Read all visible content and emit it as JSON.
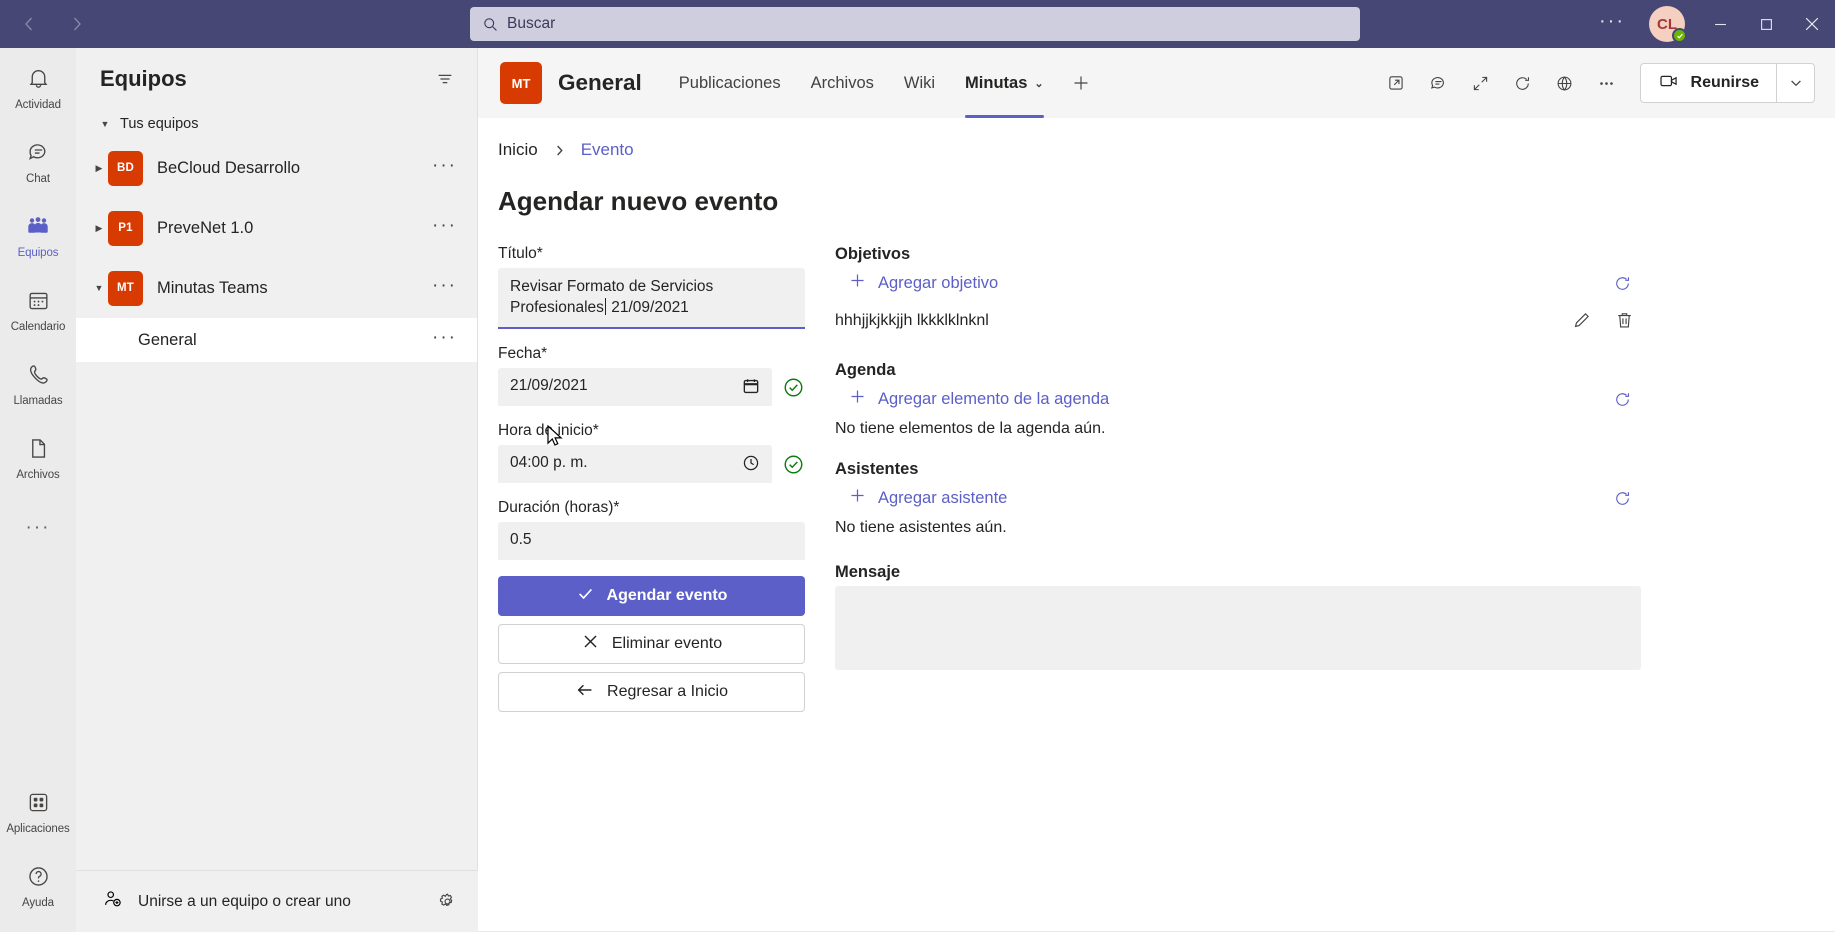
{
  "titlebar": {
    "back_tooltip": "Atrás",
    "forward_tooltip": "Adelante",
    "search_placeholder": "Buscar",
    "more_label": "···",
    "avatar_initials": "CL",
    "minimize_label": "—",
    "maximize_label": "□",
    "close_label": "✕",
    "accent_color": "#464775",
    "search_bg": "#cfcedf"
  },
  "rail": {
    "items": [
      {
        "label": "Actividad",
        "icon": "bell-icon",
        "active": false
      },
      {
        "label": "Chat",
        "icon": "chat-icon",
        "active": false
      },
      {
        "label": "Equipos",
        "icon": "teams-icon",
        "active": true
      },
      {
        "label": "Calendario",
        "icon": "calendar-icon",
        "active": false
      },
      {
        "label": "Llamadas",
        "icon": "phone-icon",
        "active": false
      },
      {
        "label": "Archivos",
        "icon": "file-icon",
        "active": false
      }
    ],
    "more_label": "···",
    "bottom": [
      {
        "label": "Aplicaciones",
        "icon": "apps-icon"
      },
      {
        "label": "Ayuda",
        "icon": "help-icon"
      }
    ],
    "active_color": "#5b5fc7"
  },
  "teams_pane": {
    "title": "Equipos",
    "filter_icon": "filter-icon",
    "section_label": "Tus equipos",
    "teams": [
      {
        "initials": "BD",
        "name": "BeCloud Desarrollo",
        "expanded": false,
        "avatar_color": "#d83b01",
        "more": "···"
      },
      {
        "initials": "P1",
        "name": "PreveNet 1.0",
        "expanded": false,
        "avatar_color": "#d83b01",
        "more": "···"
      },
      {
        "initials": "MT",
        "name": "Minutas Teams",
        "expanded": true,
        "avatar_color": "#d83b01",
        "more": "···"
      }
    ],
    "channels": [
      {
        "name": "General",
        "selected": true,
        "more": "···"
      }
    ],
    "footer_label": "Unirse a un equipo o crear uno",
    "footer_gear": "gear-icon"
  },
  "channel_header": {
    "team_initials": "MT",
    "channel_name": "General",
    "tabs": [
      {
        "label": "Publicaciones",
        "active": false,
        "has_chevron": false
      },
      {
        "label": "Archivos",
        "active": false,
        "has_chevron": false
      },
      {
        "label": "Wiki",
        "active": false,
        "has_chevron": false
      },
      {
        "label": "Minutas",
        "active": true,
        "has_chevron": true
      }
    ],
    "add_tab_label": "+",
    "actions": [
      "open-in-new-window-icon",
      "conversation-icon",
      "expand-icon",
      "refresh-icon",
      "globe-icon",
      "more-options-icon"
    ],
    "meet_button_label": "Reunirse",
    "meet_icon": "video-camera-icon",
    "meet_caret": "chevron-down-icon",
    "active_tab_color": "#5b5fc7"
  },
  "app": {
    "breadcrumb": [
      {
        "label": "Inicio",
        "is_link": false
      },
      {
        "label": "Evento",
        "is_link": true
      }
    ],
    "page_title": "Agendar nuevo evento",
    "form": {
      "title_label": "Título*",
      "title_value_before_caret": "Revisar Formato de Servicios Profesionales",
      "title_value_after_caret": " 21/09/2021",
      "date_label": "Fecha*",
      "date_value": "21/09/2021",
      "date_icon": "calendar-picker-icon",
      "date_valid_icon": "check-circle-icon",
      "time_label": "Hora de inicio*",
      "time_value": "04:00  p. m.",
      "time_icon": "clock-icon",
      "time_valid_icon": "check-circle-icon",
      "duration_label": "Duración (horas)*",
      "duration_value": "0.5",
      "submit_label": "Agendar evento",
      "submit_icon": "check-icon",
      "delete_label": "Eliminar evento",
      "delete_icon": "close-x-icon",
      "back_label": "Regresar a Inicio",
      "back_icon": "arrow-left-icon",
      "primary_color": "#5b5fc7",
      "valid_color": "#107c10"
    },
    "objectives": {
      "title": "Objetivos",
      "add_label": "Agregar objetivo",
      "refresh_icon": "refresh-icon",
      "items": [
        {
          "text": "hhhjjkjkkjjh lkkklklnknl",
          "edit_icon": "pencil-icon",
          "delete_icon": "trash-icon"
        }
      ]
    },
    "agenda": {
      "title": "Agenda",
      "add_label": "Agregar elemento de la agenda",
      "refresh_icon": "refresh-icon",
      "empty_text": "No tiene elementos de la agenda aún."
    },
    "attendees": {
      "title": "Asistentes",
      "add_label": "Agregar asistente",
      "refresh_icon": "refresh-icon",
      "empty_text": "No tiene asistentes aún."
    },
    "message": {
      "title": "Mensaje",
      "value": ""
    }
  }
}
